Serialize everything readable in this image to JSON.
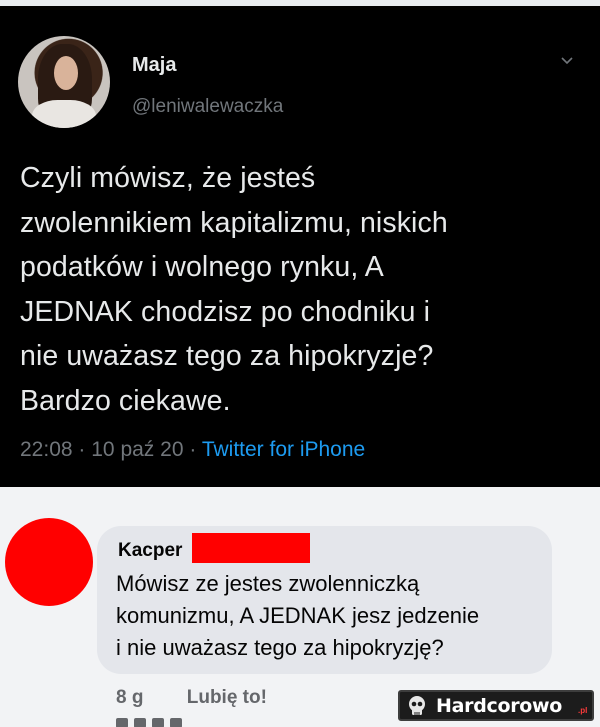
{
  "tweet": {
    "display_name": "Maja",
    "handle": "@leniwalewaczka",
    "lines": [
      "Czyli mówisz, że jesteś",
      "zwolennikiem kapitalizmu, niskich",
      "podatków i wolnego rynku, A",
      "JEDNAK chodzisz po chodniku i",
      "nie uważasz tego za hipokryzje?",
      "Bardzo ciekawe."
    ],
    "time": "22:08",
    "date": "10 paź 20",
    "source": "Twitter for iPhone",
    "separator": "·",
    "caret_icon": "chevron-down-icon"
  },
  "comment": {
    "name": "Kacper",
    "lines": [
      "Mówisz ze jestes zwolenniczką",
      "komunizmu, A JEDNAK jesz jedzenie",
      "i nie uważasz tego za hipokryzję?"
    ],
    "age": "8 g",
    "like_label": "Lubię to!",
    "redaction_color": "#ff0000"
  },
  "watermark": {
    "brand": "Hardcorowo",
    "tld": ".pl"
  },
  "colors": {
    "tweet_bg": "#000000",
    "tweet_text": "#e7e9ea",
    "tweet_muted": "#71767b",
    "twitter_blue": "#1d9bf0",
    "fb_bubble": "#e4e6eb"
  }
}
